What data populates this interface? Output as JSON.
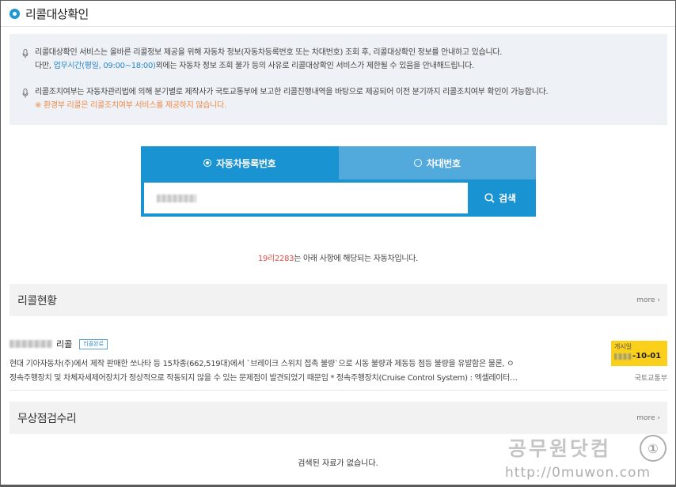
{
  "page": {
    "title": "리콜대상확인"
  },
  "notice": {
    "line1": "리콜대상확인 서비스는 올바른 리콜정보 제공을 위해 자동차 정보(자동차등록번호 또는 차대번호) 조회 후, 리콜대상확인 정보를 안내하고 있습니다.",
    "line2_prefix": "다만, ",
    "line2_link": "업무시간(평일, 09:00~18:00)",
    "line2_suffix": "외에는 자동차 정보 조회 불가 등의 사유로 리콜대상확인 서비스가 제한될 수 있음을 안내해드립니다.",
    "line3": "리콜조치여부는 자동차관리법에 의해 분기별로 제작사가 국토교통부에 보고한 리콜진행내역을 바탕으로 제공되어 이전 분기까지 리콜조치여부 확인이 가능합니다.",
    "line4": "※ 환경부 리콜은 리콜조치여부 서비스를 제공하지 않습니다."
  },
  "search": {
    "tab_registration": "자동차등록번호",
    "tab_vin": "차대번호",
    "input_value": "",
    "button_label": "검색"
  },
  "result": {
    "plate": "19리2283",
    "message": "는 아래 사항에 해당되는 자동차입니다."
  },
  "recall_section": {
    "title": "리콜현황",
    "more": "more",
    "item": {
      "name_suffix": "리콜",
      "badge": "리콜완료",
      "desc_line1": "현대 기아자동차(주)에서 제작 판매한 쏘나타 등 15차종(662,519대)에서 `브레이크 스위치 접촉 불량`으로 시동 불량과 제동등 점등 불량을 유발함은 물론, ㅇ",
      "desc_line2": "정속주행장치 및 차체자세제어장치가 정상적으로 작동되지 않을 수 있는 문제점이 발견되었기 때문임 * 정속주행장치(Cruise Control System) : 엑셀레이터…",
      "date_label": "개시일",
      "date_value": "-10-01",
      "agency": "국토교통부"
    }
  },
  "free_repair_section": {
    "title": "무상점검수리",
    "more": "more",
    "empty_message": "검색된 자료가 없습니다."
  },
  "watermark": {
    "text": "공무원닷컴",
    "url": "http://0muwon.com",
    "logo": "①"
  },
  "colors": {
    "accent": "#1a93d2",
    "tab_inactive": "#52a9db",
    "badge_date": "#fbd01c",
    "plate": "#e0524a",
    "warning": "#f08a4b"
  },
  "icons": {
    "title": "circle-dot-icon",
    "notice": "microphone-icon",
    "search": "search-icon",
    "more": "chevron-right-icon"
  }
}
